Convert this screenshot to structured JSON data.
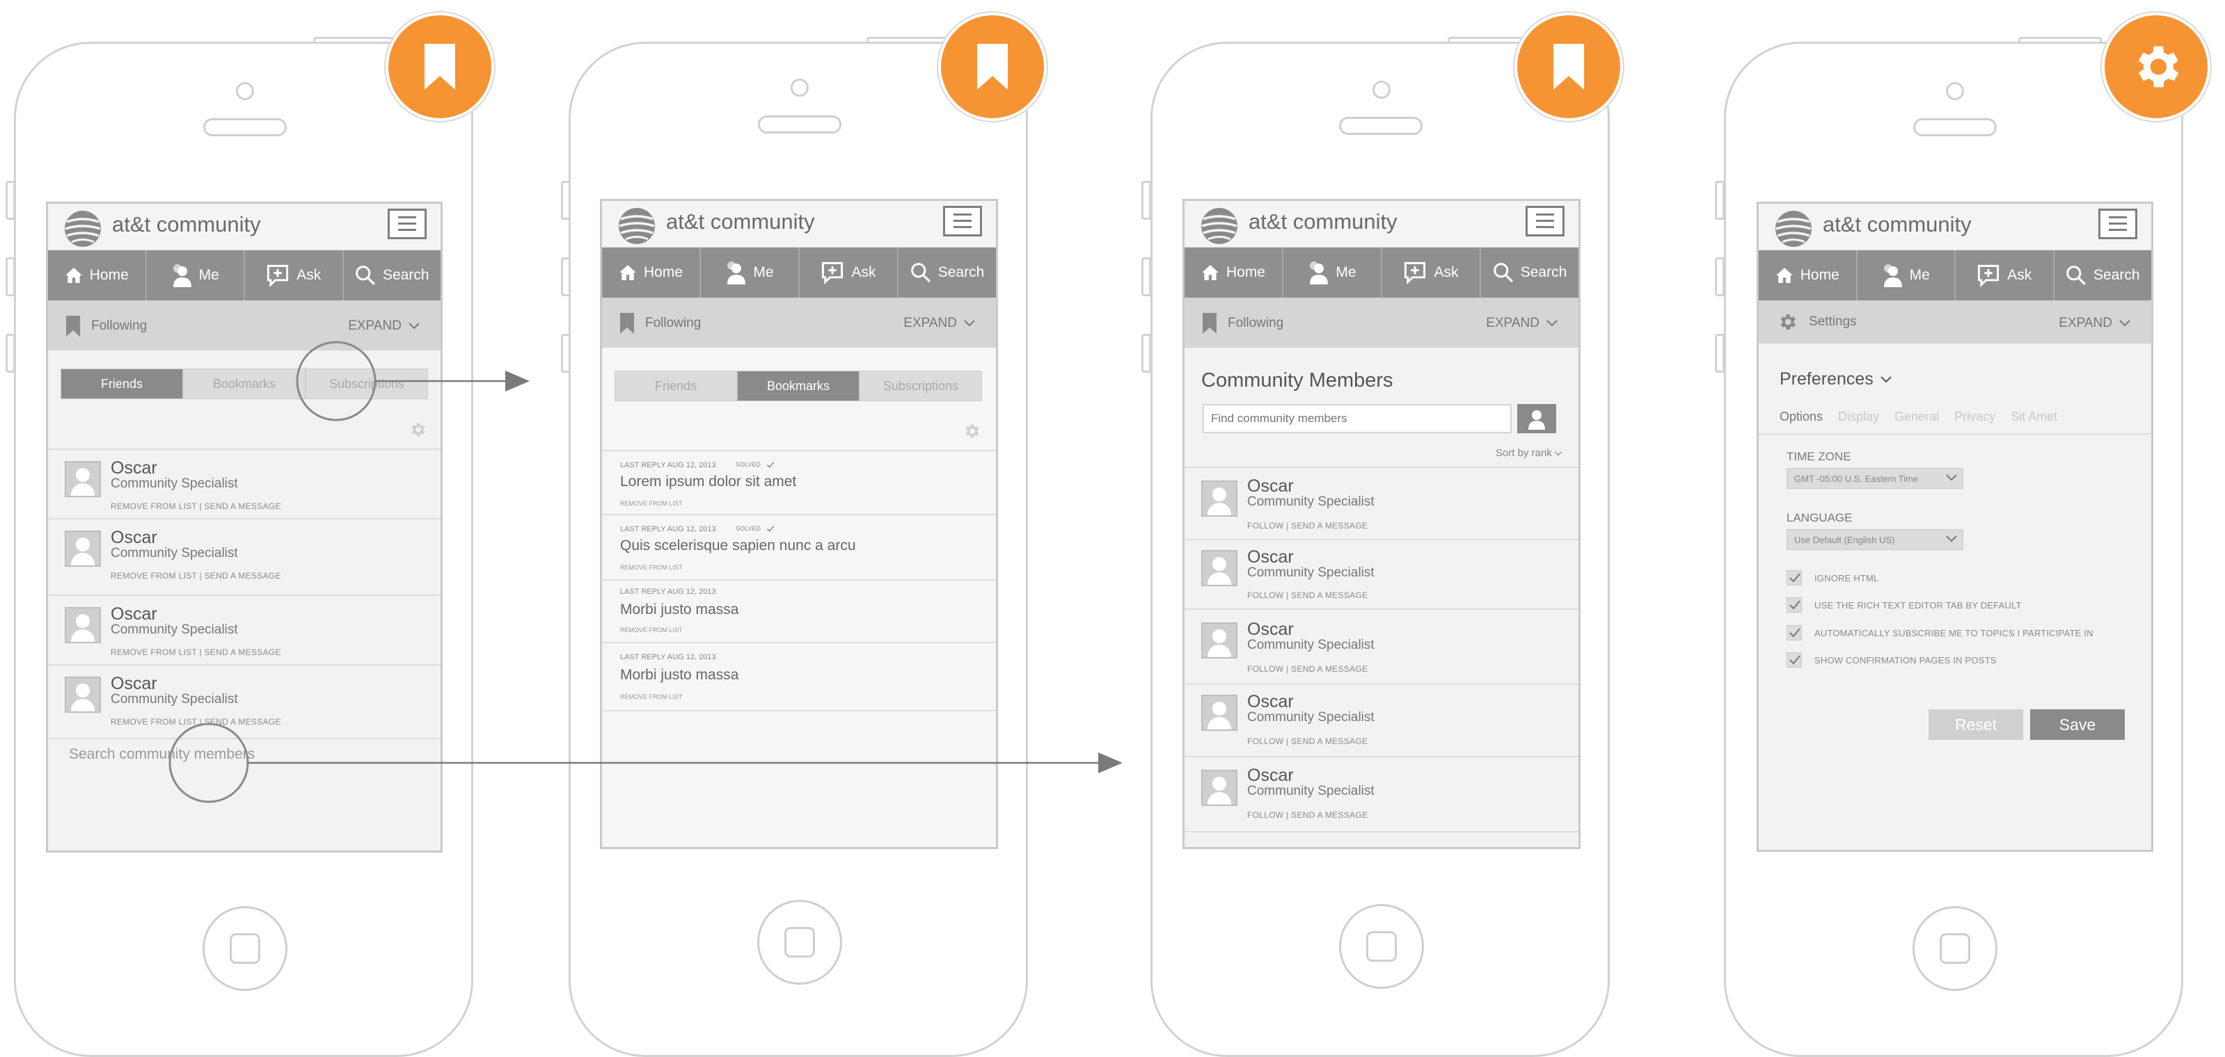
{
  "colors": {
    "accent": "#f69433",
    "nav": "#8f8f8f",
    "screen": "#f2f2f2"
  },
  "app": {
    "brand": "at&t community",
    "nav": {
      "home": "Home",
      "me": "Me",
      "ask": "Ask",
      "search": "Search"
    },
    "following": "Following",
    "settings": "Settings",
    "expand": "EXPAND"
  },
  "screen1": {
    "tabs": [
      "Friends",
      "Bookmarks",
      "Subscriptions"
    ],
    "members": [
      {
        "name": "Oscar",
        "role": "Community Specialist",
        "actions": "REMOVE FROM LIST  |  SEND A MESSAGE"
      },
      {
        "name": "Oscar",
        "role": "Community Specialist",
        "actions": "REMOVE FROM LIST  |  SEND A MESSAGE"
      },
      {
        "name": "Oscar",
        "role": "Community Specialist",
        "actions": "REMOVE FROM LIST  |  SEND A MESSAGE"
      },
      {
        "name": "Oscar",
        "role": "Community Specialist",
        "actions": "REMOVE FROM LIST  |  SEND A MESSAGE"
      }
    ],
    "search_link": "Search community members"
  },
  "screen2": {
    "tabs": [
      "Friends",
      "Bookmarks",
      "Subscriptions"
    ],
    "posts": [
      {
        "meta": "LAST REPLY AUG 12, 2013",
        "solved": "SOLVED",
        "title": "Lorem ipsum dolor sit amet",
        "remove": "REMOVE FROM LIST"
      },
      {
        "meta": "LAST REPLY AUG 12, 2013",
        "solved": "SOLVED",
        "title": "Quis scelerisque sapien nunc a arcu",
        "remove": "REMOVE FROM LIST"
      },
      {
        "meta": "LAST REPLY AUG 12, 2013",
        "solved": "",
        "title": "Morbi justo massa",
        "remove": "REMOVE FROM LIST"
      },
      {
        "meta": "LAST REPLY AUG 12, 2013",
        "solved": "",
        "title": "Morbi justo massa",
        "remove": "REMOVE FROM LIST"
      }
    ]
  },
  "screen3": {
    "heading": "Community Members",
    "search_placeholder": "Find community members",
    "sort": "Sort by rank",
    "members": [
      {
        "name": "Oscar",
        "role": "Community Specialist",
        "actions": "FOLLOW  |  SEND A MESSAGE"
      },
      {
        "name": "Oscar",
        "role": "Community Specialist",
        "actions": "FOLLOW  |  SEND A MESSAGE"
      },
      {
        "name": "Oscar",
        "role": "Community Specialist",
        "actions": "FOLLOW  |  SEND A MESSAGE"
      },
      {
        "name": "Oscar",
        "role": "Community Specialist",
        "actions": "FOLLOW  |  SEND A MESSAGE"
      },
      {
        "name": "Oscar",
        "role": "Community Specialist",
        "actions": "FOLLOW  |  SEND A MESSAGE"
      }
    ]
  },
  "screen4": {
    "preferences": "Preferences",
    "tabs": [
      "Options",
      "Display",
      "General",
      "Privacy",
      "Sit Amet"
    ],
    "timezone_label": "TIME ZONE",
    "timezone_value": "GMT -05:00 U.S. Eastern Time",
    "language_label": "LANGUAGE",
    "language_value": "Use Default (English US)",
    "options": [
      "IGNORE HTML",
      "USE THE RICH TEXT EDITOR TAB BY DEFAULT",
      "AUTOMATICALLY SUBSCRIBE ME TO TOPICS I PARTICIPATE IN",
      "SHOW CONFIRMATION PAGES IN POSTS"
    ],
    "reset": "Reset",
    "save": "Save"
  }
}
